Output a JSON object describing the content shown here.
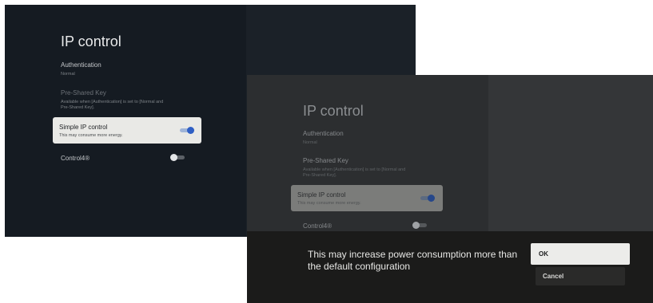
{
  "screen_a": {
    "title": "IP control",
    "authentication": {
      "label": "Authentication",
      "value": "Normal"
    },
    "psk": {
      "label": "Pre-Shared Key",
      "desc_line1": "Available when [Authentication] is set to [Normal and",
      "desc_line2": "Pre-Shared Key]."
    },
    "simple_ip": {
      "label": "Simple IP control",
      "desc": "This may consume more energy.",
      "enabled": true
    },
    "control4": {
      "label": "Control4®",
      "enabled": false
    }
  },
  "screen_b": {
    "title": "IP control",
    "authentication": {
      "label": "Authentication",
      "value": "Normal"
    },
    "psk": {
      "label": "Pre-Shared Key",
      "desc_line1": "Available when [Authentication] is set to [Normal and",
      "desc_line2": "Pre-Shared Key]."
    },
    "simple_ip": {
      "label": "Simple IP control",
      "desc": "This may consume more energy.",
      "enabled": true
    },
    "control4": {
      "label": "Control4®",
      "enabled": false
    },
    "dialog": {
      "message": "This may increase power consumption more than the default configuration",
      "ok_label": "OK",
      "cancel_label": "Cancel"
    }
  },
  "colors": {
    "background": "#151b22",
    "toggle_on": "#2f5fc4",
    "card": "#e9e9e6",
    "dialog": "#1b1b1a"
  }
}
